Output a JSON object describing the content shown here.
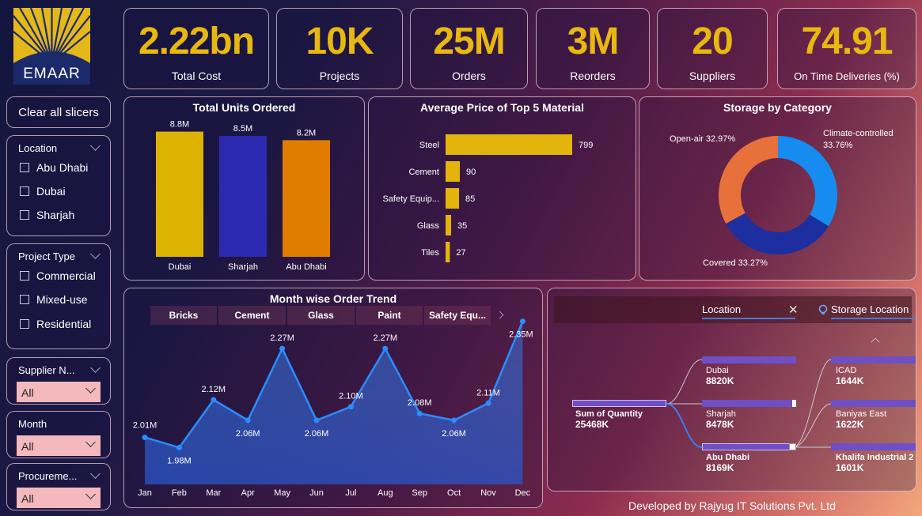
{
  "logo": {
    "text": "EMAAR"
  },
  "kpis": [
    {
      "value": "2.22bn",
      "label": "Total Cost"
    },
    {
      "value": "10K",
      "label": "Projects"
    },
    {
      "value": "25M",
      "label": "Orders"
    },
    {
      "value": "3M",
      "label": "Reorders"
    },
    {
      "value": "20",
      "label": "Suppliers"
    },
    {
      "value": "74.91",
      "label": "On Time Deliveries (%)"
    }
  ],
  "clear_button": "Clear all slicers",
  "slicers": {
    "location": {
      "title": "Location",
      "options": [
        "Abu Dhabi",
        "Dubai",
        "Sharjah"
      ]
    },
    "project_type": {
      "title": "Project Type",
      "options": [
        "Commercial",
        "Mixed-use",
        "Residential"
      ]
    },
    "supplier": {
      "title": "Supplier N...",
      "value": "All"
    },
    "month": {
      "title": "Month",
      "value": "All"
    },
    "procurement": {
      "title": "Procureme...",
      "value": "All"
    }
  },
  "footer": "Developed by Rajyug IT Solutions Pvt. Ltd",
  "units_panel": {
    "title": "Total Units Ordered"
  },
  "price_panel": {
    "title": "Average Price of Top 5 Material"
  },
  "storage_panel": {
    "title": "Storage by Category"
  },
  "trend_panel": {
    "title": "Month wise Order Trend",
    "tabs": [
      "Bricks",
      "Cement",
      "Glass",
      "Paint",
      "Safety Equ..."
    ]
  },
  "tree": {
    "header_location": "Location",
    "header_storage": "Storage Location",
    "root": {
      "label": "Sum of Quantity",
      "value": "25468K"
    },
    "level1": [
      {
        "label": "Dubai",
        "value": "8820K"
      },
      {
        "label": "Sharjah",
        "value": "8478K"
      },
      {
        "label": "Abu Dhabi",
        "value": "8169K"
      }
    ],
    "level2": [
      {
        "label": "ICAD",
        "value": "1644K"
      },
      {
        "label": "Baniyas East",
        "value": "1622K"
      },
      {
        "label": "Khalifa Industrial 2",
        "value": "1601K"
      }
    ]
  },
  "colors": {
    "gold": "#e2b40c",
    "bar_dubai": "#dcb400",
    "bar_sharjah": "#2c2ab0",
    "bar_abudhabi": "#e07c00",
    "line": "#2b8cff",
    "climate": "#168cf0",
    "covered": "#1c2ea0",
    "open_air": "#e8703a",
    "tree_bar": "#6e4fc4"
  },
  "chart_data": [
    {
      "type": "bar",
      "title": "Total Units Ordered",
      "categories": [
        "Dubai",
        "Sharjah",
        "Abu Dhabi"
      ],
      "values": [
        8.8,
        8.5,
        8.2
      ],
      "data_labels": [
        "8.8M",
        "8.5M",
        "8.2M"
      ],
      "ylim": [
        0,
        10
      ]
    },
    {
      "type": "bar",
      "orientation": "horizontal",
      "title": "Average Price of Top 5 Material",
      "categories": [
        "Steel",
        "Cement",
        "Safety Equip...",
        "Glass",
        "Tiles"
      ],
      "values": [
        799,
        90,
        85,
        35,
        27
      ]
    },
    {
      "type": "pie",
      "donut": true,
      "title": "Storage by Category",
      "labels": [
        "Climate-controlled",
        "Covered",
        "Open-air"
      ],
      "values": [
        33.76,
        33.27,
        32.97
      ],
      "data_labels": [
        "Climate-controlled 33.76%",
        "Covered 33.27%",
        "Open-air 32.97%"
      ]
    },
    {
      "type": "area",
      "title": "Month wise Order Trend",
      "categories": [
        "Jan",
        "Feb",
        "Mar",
        "Apr",
        "May",
        "Jun",
        "Jul",
        "Aug",
        "Sep",
        "Oct",
        "Nov",
        "Dec"
      ],
      "values": [
        2.01,
        1.98,
        2.12,
        2.06,
        2.27,
        2.06,
        2.1,
        2.27,
        2.08,
        2.06,
        2.11,
        2.35
      ],
      "data_labels": [
        "2.01M",
        "1.98M",
        "2.12M",
        "2.06M",
        "2.27M",
        "2.06M",
        "2.10M",
        "2.27M",
        "2.08M",
        "2.06M",
        "2.11M",
        "2.35M"
      ],
      "ylim": [
        1.9,
        2.4
      ]
    }
  ]
}
